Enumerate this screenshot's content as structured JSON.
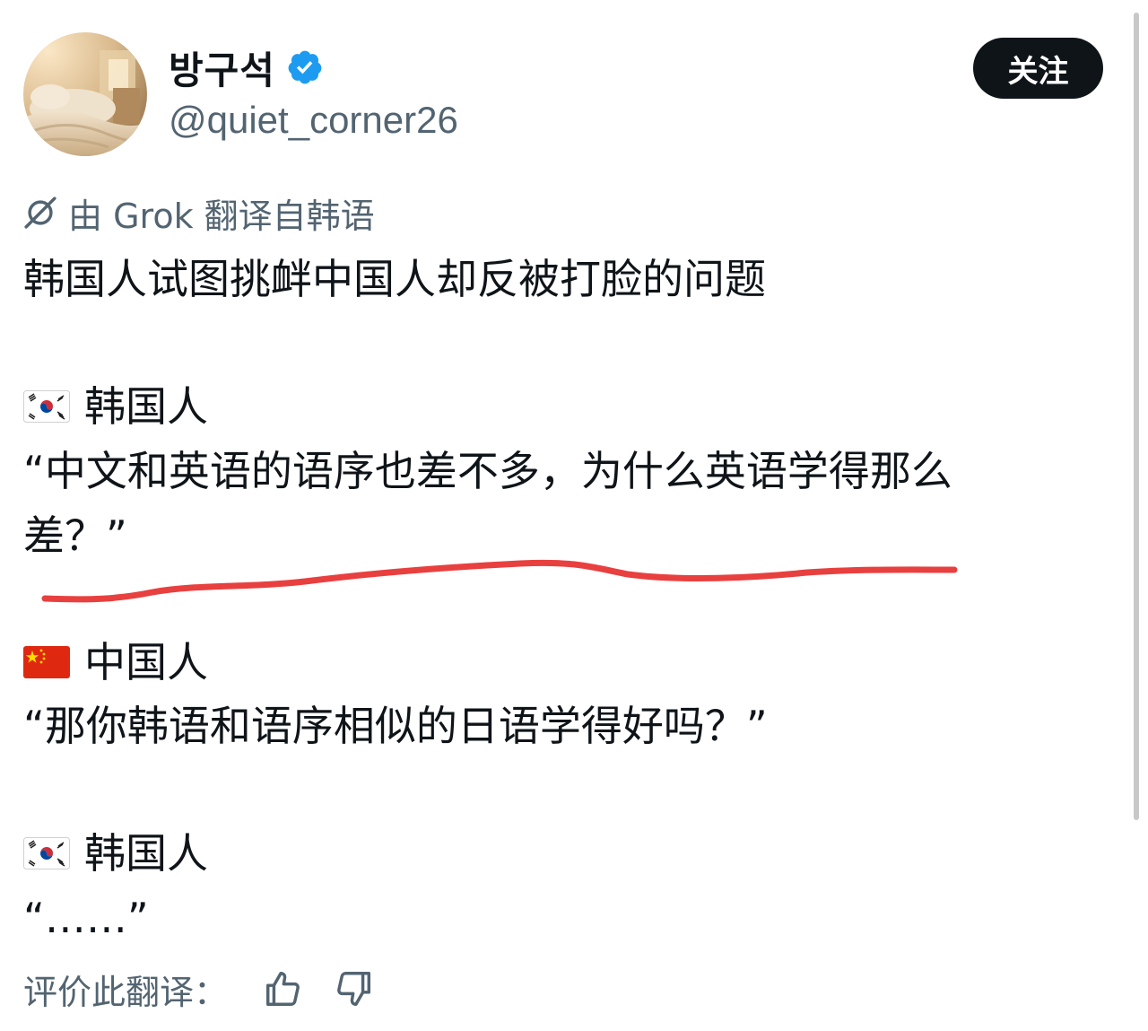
{
  "author": {
    "display_name": "방구석",
    "handle": "@quiet_corner26",
    "verified_icon": "verified-badge-icon",
    "avatar_icon": "bedroom-photo"
  },
  "follow_button": {
    "label": "关注"
  },
  "translation_notice": {
    "icon": "grok-icon",
    "text": "由 Grok 翻译自韩语"
  },
  "post": {
    "title": "韩国人试图挑衅中国人却反被打脸的问题",
    "dialogue": [
      {
        "flag": "south-korea-flag",
        "speaker": "韩国人",
        "quote_line1": "“中文和英语的语序也差不多，为什么英语学得那么",
        "quote_line2": "差？”"
      },
      {
        "flag": "china-flag",
        "speaker": "中国人",
        "quote_line1": "“那你韩语和语序相似的日语学得好吗？”"
      },
      {
        "flag": "south-korea-flag",
        "speaker": "韩国人",
        "quote_line1": "“……”"
      }
    ]
  },
  "rating": {
    "label": "评价此翻译：",
    "thumbs_up_icon": "thumbs-up-icon",
    "thumbs_down_icon": "thumbs-down-icon"
  },
  "colors": {
    "text_primary": "#0f1419",
    "text_secondary": "#536471",
    "verified_blue": "#1d9bf0",
    "follow_bg": "#0f1419",
    "annotation_red": "#e8403f"
  }
}
